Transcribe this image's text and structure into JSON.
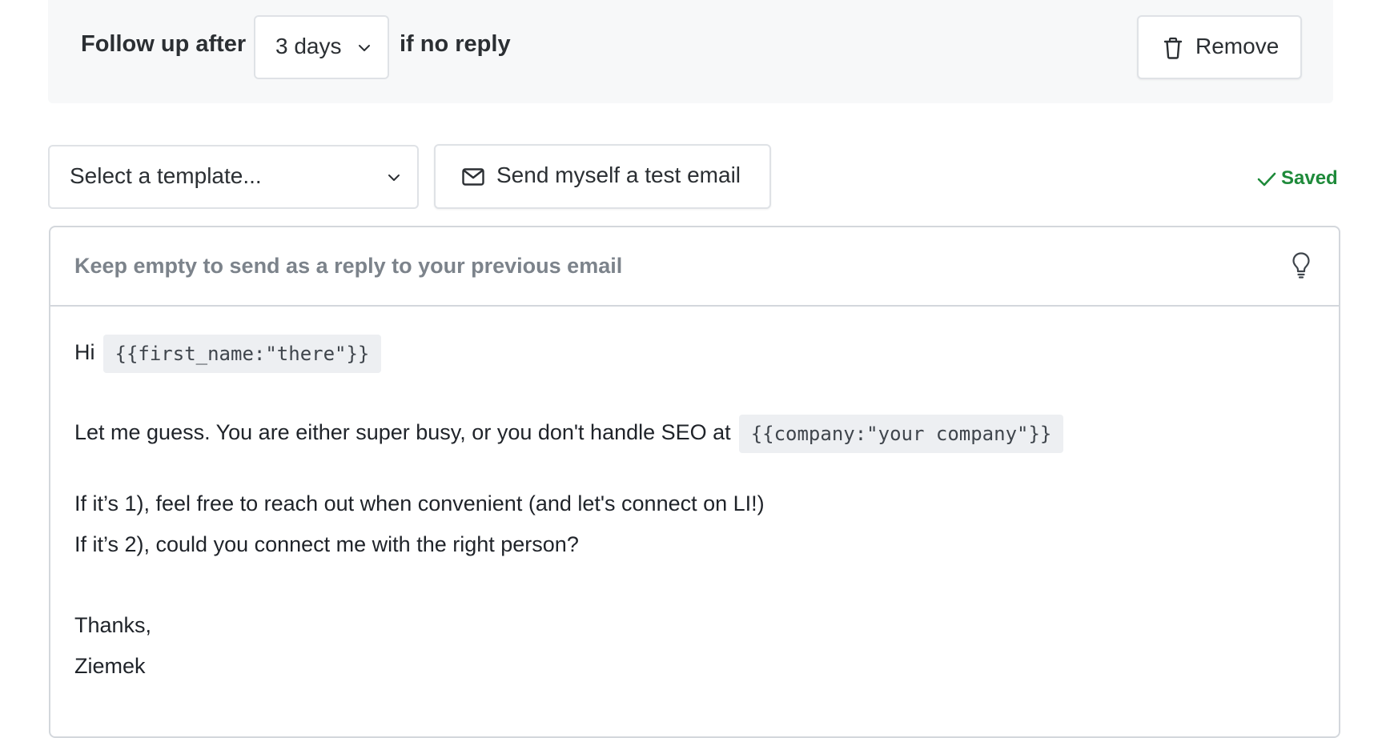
{
  "followup": {
    "label": "Follow up after",
    "delay_value": "3 days",
    "suffix": "if no reply",
    "remove_label": "Remove"
  },
  "toolbar": {
    "template_placeholder": "Select a template...",
    "test_email_label": "Send myself a test email",
    "status": "Saved"
  },
  "editor": {
    "subject_placeholder": "Keep empty to send as a reply to your previous email",
    "subject_value": "",
    "body": {
      "greeting": "Hi",
      "var_first_name": "{{first_name:\"there\"}}",
      "line2": "Let me guess. You are either super busy, or you don't handle SEO at",
      "var_company": "{{company:\"your company\"}}",
      "line3": "If it’s 1), feel free to reach out when convenient (and let's connect on LI!)",
      "line4": "If it’s 2), could you connect me with the right person?",
      "sign_off": "Thanks,",
      "signature": "Ziemek"
    }
  },
  "icons": {
    "delay_chevron": "chevron-down-icon",
    "remove": "trash-icon",
    "template_chevron": "chevron-down-icon",
    "test_email": "envelope-icon",
    "status": "checkmark-icon",
    "subject_hint": "lightbulb-icon"
  },
  "colors": {
    "status_saved": "#1e8a3a",
    "panel_background": "#f7f8f9",
    "chip_background": "#edeff2"
  }
}
